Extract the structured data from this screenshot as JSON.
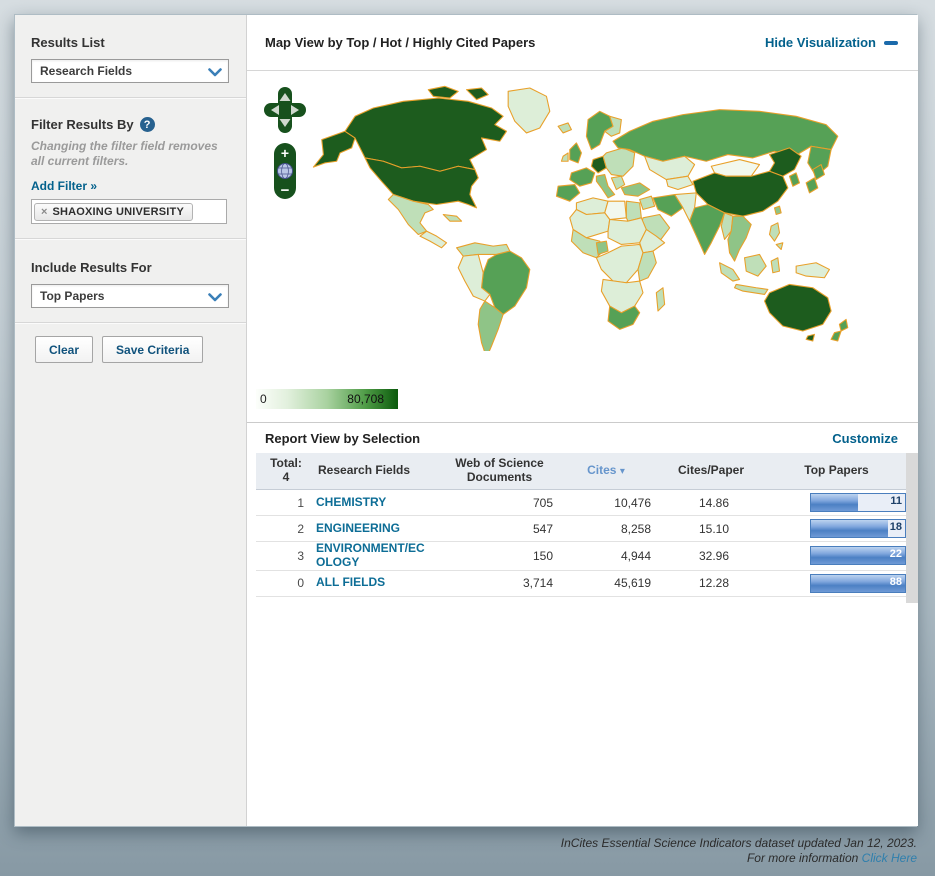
{
  "sidebar": {
    "results_list": {
      "label": "Results List",
      "selected": "Research Fields"
    },
    "filter": {
      "title": "Filter Results By",
      "help_icon": "?",
      "note": "Changing the filter field removes all current filters.",
      "add_filter_label": "Add Filter »",
      "active_filters": [
        {
          "remove_icon": "×",
          "label": "SHAOXING UNIVERSITY"
        }
      ]
    },
    "include": {
      "label": "Include Results For",
      "selected": "Top Papers"
    },
    "buttons": {
      "clear": "Clear",
      "save": "Save Criteria"
    }
  },
  "map_panel": {
    "title": "Map View by Top / Hot / Highly Cited Papers",
    "hide_link": "Hide Visualization",
    "controls": {
      "zoom_in": "+",
      "zoom_out": "−"
    },
    "legend": {
      "min": "0",
      "max": "80,708",
      "gradient_stops": [
        "#fcfefb 0%",
        "#e2f0dd 22%",
        "#a9d2a0 50%",
        "#4c9a44 78%",
        "#0b5a0c 100%"
      ]
    },
    "border_color": "#e8a02a",
    "palette": {
      "0": "#f2f8ee",
      "1": "#ddeed8",
      "2": "#bfdfb8",
      "3": "#8fc487",
      "4": "#56a156",
      "5": "#1d5c1e"
    },
    "shading_levels": {
      "darkest": [
        "USA",
        "Canada",
        "Alaska",
        "China",
        "Australia",
        "Germany"
      ],
      "high": [
        "Russia",
        "Brazil",
        "India",
        "France",
        "Spain",
        "Scandinavia",
        "UK",
        "Iran",
        "South Africa",
        "Japan",
        "South Korea",
        "New Zealand"
      ],
      "medium": [
        "Argentina",
        "Italy",
        "Turkey",
        "Nigeria",
        "Southeast Asia",
        "Taiwan"
      ],
      "light": [
        "Mexico",
        "Egypt",
        "Saudi Arabia",
        "Eastern Europe",
        "Indonesia",
        "Madagascar",
        "Philippines",
        "Northern South America",
        "Iceland",
        "Finland"
      ],
      "pale": [
        "Most of Africa",
        "Central Asia",
        "Peru/Bolivia",
        "Central America",
        "Greenland",
        "New Guinea"
      ],
      "near_white": [
        "Mongolia",
        "Libya"
      ]
    }
  },
  "report": {
    "title": "Report View by Selection",
    "customize_label": "Customize",
    "header": {
      "total_label": "Total:",
      "total_value": "4",
      "col_field": "Research Fields",
      "col_docs": "Web of Science Documents",
      "col_cites": "Cites",
      "sort_arrow": "▾",
      "col_cites_paper": "Cites/Paper",
      "col_top_papers": "Top Papers"
    },
    "sorted_column": "Cites",
    "rows": [
      {
        "rank": "1",
        "field": "CHEMISTRY",
        "docs": "705",
        "cites": "10,476",
        "cites_per_paper": "14.86",
        "top_papers": "11",
        "bar_pct": 50
      },
      {
        "rank": "2",
        "field": "ENGINEERING",
        "docs": "547",
        "cites": "8,258",
        "cites_per_paper": "15.10",
        "top_papers": "18",
        "bar_pct": 82
      },
      {
        "rank": "3",
        "field": "ENVIRONMENT/ECOLOGY",
        "docs": "150",
        "cites": "4,944",
        "cites_per_paper": "32.96",
        "top_papers": "22",
        "bar_pct": 100
      },
      {
        "rank": "0",
        "field": "ALL FIELDS",
        "docs": "3,714",
        "cites": "45,619",
        "cites_per_paper": "12.28",
        "top_papers": "88",
        "bar_pct": 100
      }
    ]
  },
  "footer": {
    "line1": "InCites Essential Science Indicators dataset updated Jan 12, 2023.",
    "line2_text": "For more information ",
    "line2_link": "Click Here"
  },
  "colors": {
    "accent_teal": "#03618c",
    "sorted_header_blue": "#6695cc",
    "bar_border_blue": "#4a7ebd",
    "control_green": "#17511d"
  }
}
